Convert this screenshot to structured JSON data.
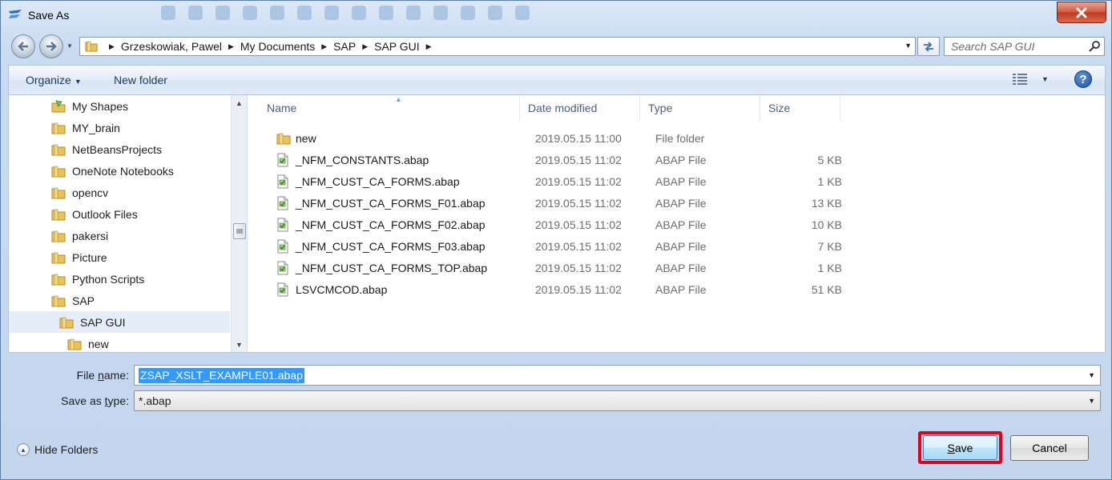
{
  "window": {
    "title": "Save As"
  },
  "breadcrumb": [
    "Grzeskowiak, Pawel",
    "My Documents",
    "SAP",
    "SAP GUI"
  ],
  "search": {
    "placeholder": "Search SAP GUI"
  },
  "commandbar": {
    "organize": "Organize",
    "new_folder": "New folder",
    "help": "?"
  },
  "nav_tree": [
    {
      "label": "My Shapes",
      "icon": "shapes-folder-icon"
    },
    {
      "label": "MY_brain",
      "icon": "folder-icon"
    },
    {
      "label": "NetBeansProjects",
      "icon": "folder-icon"
    },
    {
      "label": "OneNote Notebooks",
      "icon": "folder-icon"
    },
    {
      "label": "opencv",
      "icon": "folder-icon"
    },
    {
      "label": "Outlook Files",
      "icon": "folder-icon"
    },
    {
      "label": "pakersi",
      "icon": "folder-icon"
    },
    {
      "label": "Picture",
      "icon": "folder-icon"
    },
    {
      "label": "Python Scripts",
      "icon": "folder-icon"
    },
    {
      "label": "SAP",
      "icon": "folder-icon"
    },
    {
      "label": "SAP GUI",
      "icon": "folder-icon",
      "selected": true
    },
    {
      "label": "new",
      "icon": "folder-icon"
    }
  ],
  "columns": {
    "name": "Name",
    "date": "Date modified",
    "type": "Type",
    "size": "Size"
  },
  "files": [
    {
      "name": "new",
      "date": "2019.05.15 11:00",
      "type": "File folder",
      "size": "",
      "icon": "folder-icon"
    },
    {
      "name": "_NFM_CONSTANTS.abap",
      "date": "2019.05.15 11:02",
      "type": "ABAP File",
      "size": "5 KB",
      "icon": "abap-file-icon"
    },
    {
      "name": "_NFM_CUST_CA_FORMS.abap",
      "date": "2019.05.15 11:02",
      "type": "ABAP File",
      "size": "1 KB",
      "icon": "abap-file-icon"
    },
    {
      "name": "_NFM_CUST_CA_FORMS_F01.abap",
      "date": "2019.05.15 11:02",
      "type": "ABAP File",
      "size": "13 KB",
      "icon": "abap-file-icon"
    },
    {
      "name": "_NFM_CUST_CA_FORMS_F02.abap",
      "date": "2019.05.15 11:02",
      "type": "ABAP File",
      "size": "10 KB",
      "icon": "abap-file-icon"
    },
    {
      "name": "_NFM_CUST_CA_FORMS_F03.abap",
      "date": "2019.05.15 11:02",
      "type": "ABAP File",
      "size": "7 KB",
      "icon": "abap-file-icon"
    },
    {
      "name": "_NFM_CUST_CA_FORMS_TOP.abap",
      "date": "2019.05.15 11:02",
      "type": "ABAP File",
      "size": "1 KB",
      "icon": "abap-file-icon"
    },
    {
      "name": "LSVCMCOD.abap",
      "date": "2019.05.15 11:02",
      "type": "ABAP File",
      "size": "51 KB",
      "icon": "abap-file-icon"
    }
  ],
  "form": {
    "file_name_label_pre": "File ",
    "file_name_label_key": "n",
    "file_name_label_post": "ame:",
    "file_name_value": "ZSAP_XSLT_EXAMPLE01.abap",
    "save_type_label_pre": "Save as ",
    "save_type_label_key": "t",
    "save_type_label_post": "ype:",
    "save_type_value": "*.abap"
  },
  "footer": {
    "hide_folders": "Hide Folders",
    "save_key": "S",
    "save_rest": "ave",
    "cancel": "Cancel"
  },
  "colors": {
    "highlight": "#e2001a",
    "selection": "#3399ff",
    "accent": "#1e395b"
  }
}
